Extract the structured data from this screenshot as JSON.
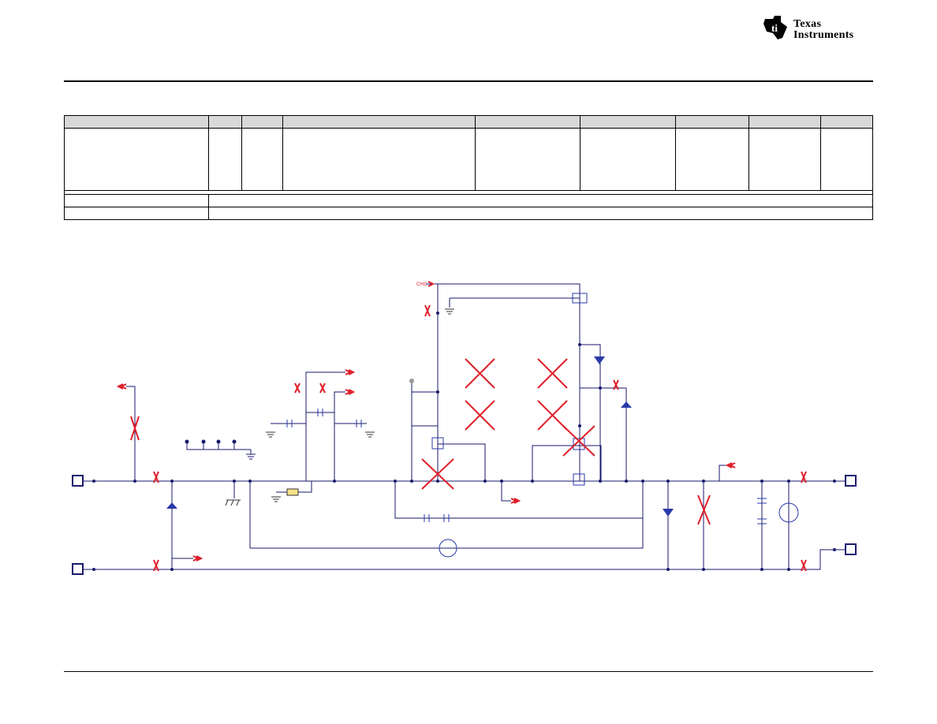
{
  "header": {
    "logo_line1": "Texas",
    "logo_line2": "Instruments",
    "logo_icon": "ti-state-icon"
  },
  "schematic": {
    "net_label": "CHG"
  },
  "colors": {
    "wire": "#1a1a6e",
    "component": "#2a3aa8",
    "no_populate": "#e0202a",
    "text_red": "#e0202a"
  }
}
